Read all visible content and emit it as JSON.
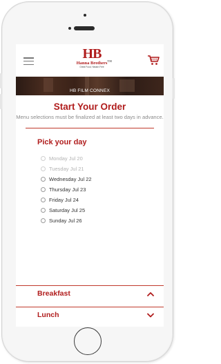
{
  "header": {
    "logo_mark": "HB",
    "logo_name": "Hanna Brothers",
    "logo_trademark": "TM",
    "logo_tagline": "Great Food, Hassle-Free"
  },
  "banner": {
    "caption": "HB FILM CONNEX"
  },
  "order": {
    "title": "Start Your Order",
    "note": "Menu selections must be finalized at least two days in advance."
  },
  "pick_day": {
    "title": "Pick your day",
    "days": [
      {
        "label": "Monday Jul 20",
        "available": false
      },
      {
        "label": "Tuesday Jul 21",
        "available": false
      },
      {
        "label": "Wednesday Jul 22",
        "available": true
      },
      {
        "label": "Thursday Jul 23",
        "available": true
      },
      {
        "label": "Friday Jul 24",
        "available": true
      },
      {
        "label": "Saturday Jul 25",
        "available": true
      },
      {
        "label": "Sunday Jul 26",
        "available": true
      }
    ]
  },
  "meals": [
    {
      "label": "Breakfast",
      "expanded": true
    },
    {
      "label": "Lunch",
      "expanded": false
    }
  ],
  "colors": {
    "brand": "#b01c1c",
    "divider": "#c0392b"
  },
  "icons": {
    "menu": "hamburger-icon",
    "cart": "cart-icon",
    "chevron_up": "chevron-up-icon",
    "chevron_down": "chevron-down-icon"
  }
}
